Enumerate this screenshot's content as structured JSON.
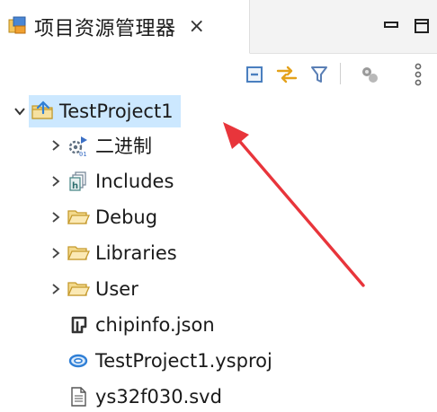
{
  "view": {
    "title": "项目资源管理器",
    "close_symbol": "×"
  },
  "tree": {
    "root": {
      "label": "TestProject1",
      "icon": "project-folder-icon"
    },
    "items": [
      {
        "label": "二进制",
        "icon": "binaries-icon",
        "expandable": true
      },
      {
        "label": "Includes",
        "icon": "includes-icon",
        "expandable": true
      },
      {
        "label": "Debug",
        "icon": "folder-icon",
        "expandable": true
      },
      {
        "label": "Libraries",
        "icon": "folder-icon",
        "expandable": true
      },
      {
        "label": "User",
        "icon": "folder-icon",
        "expandable": true
      },
      {
        "label": "chipinfo.json",
        "icon": "json-file-icon",
        "expandable": false
      },
      {
        "label": "TestProject1.ysproj",
        "icon": "project-file-icon",
        "expandable": false
      },
      {
        "label": "ys32f030.svd",
        "icon": "text-file-icon",
        "expandable": false
      }
    ]
  },
  "colors": {
    "selection": "#cce8ff",
    "annotation_arrow": "#e8353b",
    "folder": "#e9b949",
    "project_blue": "#2f7fd6"
  }
}
